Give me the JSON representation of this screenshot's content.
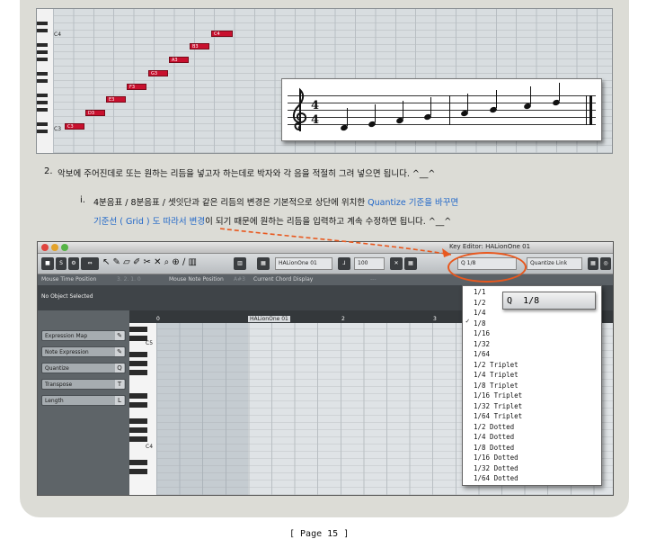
{
  "top_roll": {
    "key_labels": [
      "C4",
      "C3"
    ],
    "notes": [
      "C3",
      "D3",
      "E3",
      "F3",
      "G3",
      "A3",
      "B3",
      "C4"
    ]
  },
  "instruction": {
    "item2_num": "2.",
    "item2_text": "악보에 주어진데로 또는 원하는 리듬을 넣고자 하는데로 박자와 각 음을 적절히 그려 넣으면 됩니다. ^__^",
    "item_i_num": "i.",
    "line1_black": "4분음표 / 8분음표 / 셋잇단과 같은 리듬의 변경은 기본적으로 상단에 위치한 ",
    "line1_blue": "Quantize 기준을 바꾸면",
    "line2_blue": "기준선 ( Grid ) 도 따라서 변경",
    "line2_black": "이 되기 때문에 원하는 리듬을 입력하고 계속 수정하면 됩니다. ^__^"
  },
  "editor": {
    "window_title": "Key Editor: HALionOne 01",
    "track_name": "HALionOne 01",
    "quantize_value": "1/8",
    "length_value": "100",
    "quantize_link": "Quantize Link",
    "info_mouse_time": "Mouse Time Position",
    "info_time_value": "3. 2. 1. 0",
    "info_mouse_note": "Mouse Note Position",
    "info_note_value": "A#3",
    "info_chord": "Current Chord Display",
    "info_chord_value": "---",
    "no_object": "No Object Selected",
    "lanes": [
      "Expression Map",
      "Note Expression",
      "Quantize",
      "Transpose",
      "Length"
    ],
    "lane_icons": [
      "✎",
      "✎",
      "Q",
      "T",
      "L"
    ],
    "ruler_marks": [
      "0",
      "HALionOne 01",
      "2",
      "3"
    ],
    "key_labels": [
      "C5",
      "C4"
    ]
  },
  "quantize_menu": {
    "callout": "1/8",
    "options": [
      "1/1",
      "1/2",
      "1/4",
      "1/8",
      "1/16",
      "1/32",
      "1/64",
      "1/2  Triplet",
      "1/4  Triplet",
      "1/8  Triplet",
      "1/16  Triplet",
      "1/32  Triplet",
      "1/64  Triplet",
      "1/2  Dotted",
      "1/4  Dotted",
      "1/8  Dotted",
      "1/16  Dotted",
      "1/32  Dotted",
      "1/64  Dotted"
    ],
    "selected": "1/8",
    "checkmark": "✓"
  },
  "footer": {
    "page": "[ Page 15 ]"
  },
  "colors": {
    "note_red": "#c8102e",
    "highlight_blue": "#1f66c8",
    "callout_orange": "#e8581e"
  }
}
